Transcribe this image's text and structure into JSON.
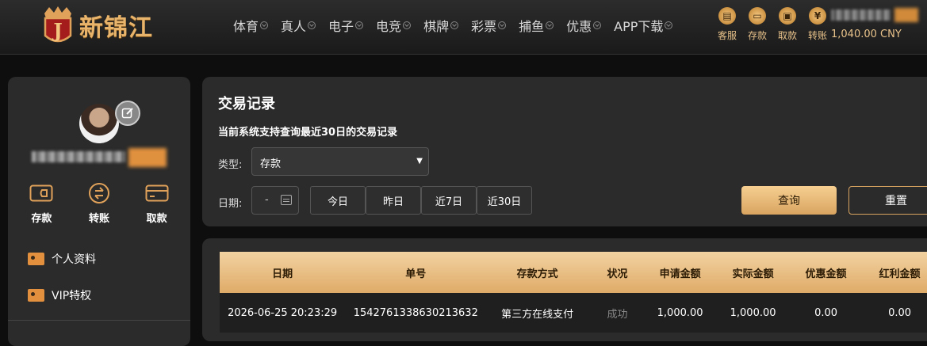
{
  "header": {
    "logo_text": "新锦江",
    "logo_letter": "J",
    "nav": [
      "体育",
      "真人",
      "电子",
      "电竞",
      "棋牌",
      "彩票",
      "捕鱼",
      "优惠",
      "APP下载"
    ],
    "quick_links": [
      {
        "label": "客服",
        "icon": "chat-icon",
        "glyph": "💬"
      },
      {
        "label": "存款",
        "icon": "wallet-icon",
        "glyph": "▭"
      },
      {
        "label": "取款",
        "icon": "briefcase-icon",
        "glyph": "▤"
      },
      {
        "label": "转账",
        "icon": "coin-icon",
        "glyph": "$"
      }
    ],
    "balance": "1,040.00 CNY"
  },
  "sidebar": {
    "actions": [
      {
        "label": "存款",
        "icon": "wallet-icon"
      },
      {
        "label": "转账",
        "icon": "transfer-icon"
      },
      {
        "label": "取款",
        "icon": "card-icon"
      }
    ],
    "menu": [
      {
        "label": "个人资料",
        "icon": "profile-card-icon"
      },
      {
        "label": "VIP特权",
        "icon": "vip-card-icon"
      }
    ]
  },
  "panel": {
    "title": "交易记录",
    "subtitle": "当前系统支持查询最近30日的交易记录",
    "type_label": "类型:",
    "type_value": "存款",
    "date_label": "日期:",
    "date_value": "-",
    "quick_ranges": [
      "今日",
      "昨日",
      "近7日",
      "近30日"
    ],
    "search_label": "查询",
    "reset_label": "重置"
  },
  "table": {
    "headers": [
      "日期",
      "单号",
      "存款方式",
      "状况",
      "申请金额",
      "实际金额",
      "优惠金额",
      "红利金额"
    ],
    "rows": [
      [
        "2026-06-25 20:23:29",
        "1542761338630213632",
        "第三方在线支付",
        "成功",
        "1,000.00",
        "1,000.00",
        "0.00",
        "0.00"
      ]
    ]
  },
  "colors": {
    "accent": "#e0a25a",
    "panel_bg": "#2b2b2b",
    "page_bg": "#0e0e0e"
  }
}
